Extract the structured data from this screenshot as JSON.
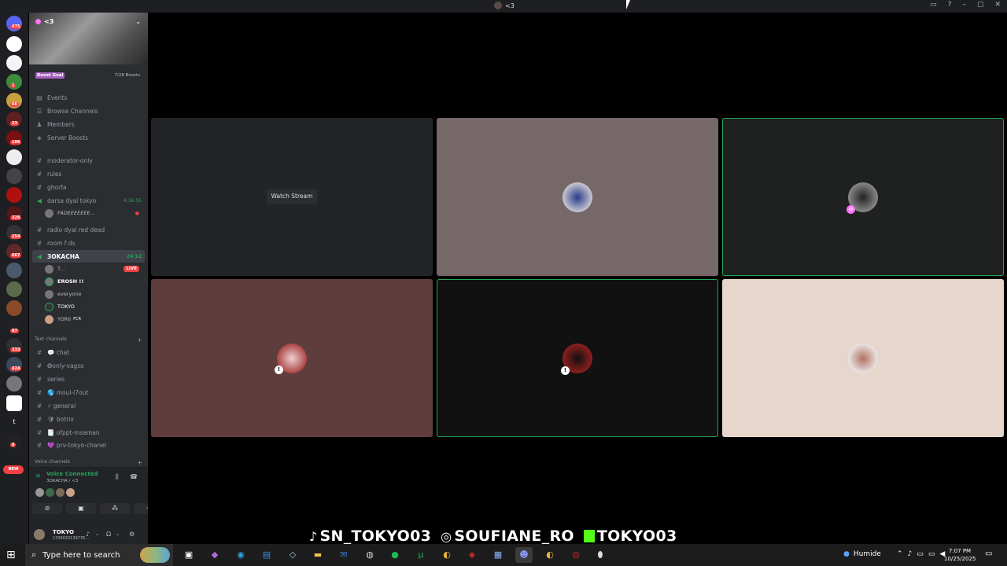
{
  "titlebar": {
    "title": "<3"
  },
  "rail": {
    "badges": [
      "475",
      "1",
      "66",
      "23",
      "196",
      "326",
      "254",
      "667",
      "87",
      "333",
      "424",
      "8"
    ],
    "new_label": "NEW"
  },
  "server": {
    "name": "<3",
    "boost_goal_label": "Boost Goal",
    "boost_count": "7/28 Boosts"
  },
  "menu": [
    {
      "icon": "calendar-icon",
      "label": "Events"
    },
    {
      "icon": "browse-icon",
      "label": "Browse Channels"
    },
    {
      "icon": "members-icon",
      "label": "Members"
    },
    {
      "icon": "boost-icon",
      "label": "Server Boosts"
    }
  ],
  "channels_top": [
    {
      "type": "text",
      "label": "moderator-only"
    },
    {
      "type": "text",
      "label": "rules"
    },
    {
      "type": "text",
      "label": "ghorfa"
    }
  ],
  "voice_darsa": {
    "label": "darsa dyal tokyo",
    "time": "4:36:55",
    "user": "FADEEEEEEE…"
  },
  "channels_mid": [
    {
      "type": "text",
      "label": "radio dyal red dead"
    },
    {
      "type": "text",
      "label": "room f ds"
    }
  ],
  "voice_active": {
    "label": "3OKACHA",
    "time": "24:12"
  },
  "voice_users": [
    {
      "name": "T...",
      "tag": "LIVE"
    },
    {
      "name": "EROSH !!"
    },
    {
      "name": "everyone"
    },
    {
      "name": "TOKYO"
    },
    {
      "name": "YORII",
      "tag": "FCR"
    }
  ],
  "text_section": {
    "label": "Text channels"
  },
  "text_channels": [
    {
      "label": "💬 chat"
    },
    {
      "label": "❂only-vagos"
    },
    {
      "label": "series"
    },
    {
      "label": "🌎 moul-l7out"
    },
    {
      "label": "⚡ general"
    },
    {
      "label": "🛡 botrix"
    },
    {
      "label": "📑 ofppt-msaman"
    },
    {
      "label": "💜 prv-tokyo-chanel"
    }
  ],
  "voice_section": {
    "label": "Voice channels"
  },
  "voice_panel": {
    "status": "Voice Connected",
    "channel": "3OKACHA / <3"
  },
  "user_panel": {
    "name": "TOKYO",
    "id": "1339020139735…"
  },
  "tiles": [
    {
      "watch_label": "Watch Stream",
      "bg": "#232428"
    },
    {
      "bg": "#766769"
    },
    {
      "bg": "#1f2020"
    },
    {
      "bg": "#5f3d3d"
    },
    {
      "bg": "#111111"
    },
    {
      "bg": "#e6d6cb"
    }
  ],
  "socials": {
    "tiktok": "SN_TOKYO03",
    "instagram": "SOUFIANE_RO",
    "kick": "TOKYO03"
  },
  "taskbar": {
    "search_placeholder": "Type here to search",
    "weather": "Humide",
    "time": "7:07 PM",
    "date": "10/25/2025"
  },
  "colors": {
    "accent_green": "#23a55a",
    "live_red": "#f23f43",
    "bg_dark": "#2b2d31"
  }
}
